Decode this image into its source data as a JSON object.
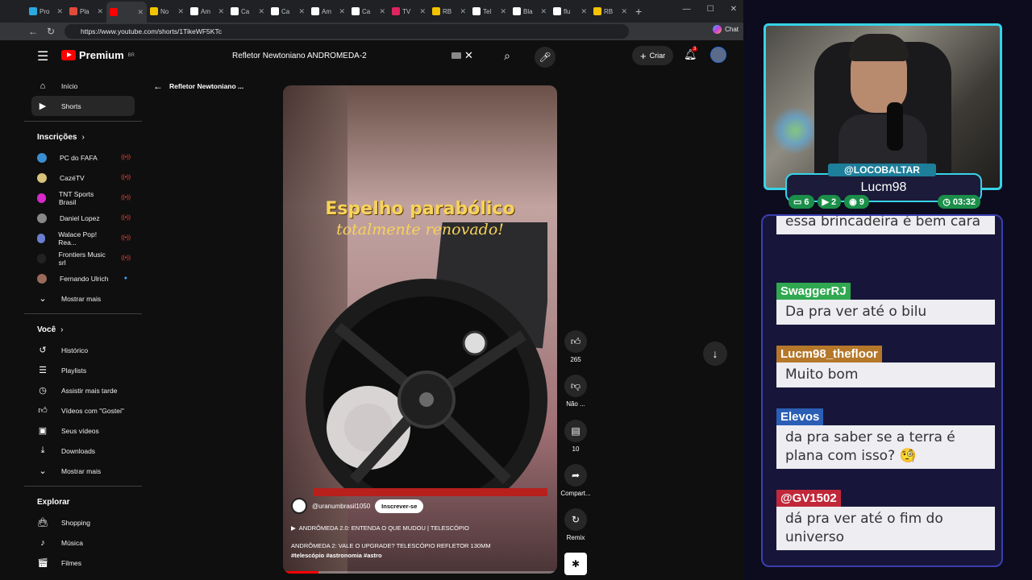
{
  "browser": {
    "tabs": [
      {
        "label": "Pro",
        "color": "#29a9e0"
      },
      {
        "label": "Pla",
        "color": "#e24a3a"
      },
      {
        "label": "",
        "color": "#ff0000"
      },
      {
        "label": "No",
        "color": "#f4c300"
      },
      {
        "label": "Am",
        "color": "#ffffff"
      },
      {
        "label": "Ca",
        "color": "#ffffff"
      },
      {
        "label": "Ca",
        "color": "#ffffff"
      },
      {
        "label": "Am",
        "color": "#ffffff"
      },
      {
        "label": "Ca",
        "color": "#ffffff"
      },
      {
        "label": "TV",
        "color": "#e0245e"
      },
      {
        "label": "RB",
        "color": "#f4c300"
      },
      {
        "label": "Tel",
        "color": "#ffffff"
      },
      {
        "label": "Bla",
        "color": "#ffffff"
      },
      {
        "label": "flu",
        "color": "#ffffff"
      },
      {
        "label": "RB",
        "color": "#f4c300"
      }
    ],
    "url": "https://www.youtube.com/shorts/1TikeWF5KTc",
    "chat_label": "Chat"
  },
  "youtube": {
    "logo_text": "Premium",
    "logo_region": "BR",
    "search_value": "Refletor Newtoniano ANDRÔMEDA-2",
    "create_label": "Criar",
    "notification_count": "3",
    "sidebar": {
      "main": [
        {
          "label": "Início",
          "icon": "home-icon"
        },
        {
          "label": "Shorts",
          "icon": "shorts-icon"
        }
      ],
      "subs_heading": "Inscrições",
      "subs": [
        {
          "label": "PC do FAFA",
          "color": "#3a8fd1",
          "status": "live"
        },
        {
          "label": "CazéTV",
          "color": "#d9c27a",
          "status": "live"
        },
        {
          "label": "TNT Sports Brasil",
          "color": "#d629c9",
          "status": "live"
        },
        {
          "label": "Daniel Lopez",
          "color": "#888888",
          "status": "live"
        },
        {
          "label": "Walace Pop! Rea...",
          "color": "#6a7fd1",
          "status": "live"
        },
        {
          "label": "Frontiers Music srl",
          "color": "#222222",
          "status": "live"
        },
        {
          "label": "Fernando Ulrich",
          "color": "#9a6a5a",
          "status": "new"
        }
      ],
      "subs_more": "Mostrar mais",
      "you_heading": "Você",
      "you": [
        {
          "label": "Histórico",
          "icon": "history-icon"
        },
        {
          "label": "Playlists",
          "icon": "playlists-icon"
        },
        {
          "label": "Assistir mais tarde",
          "icon": "clock-icon"
        },
        {
          "label": "Vídeos com \"Gostei\"",
          "icon": "like-icon"
        },
        {
          "label": "Seus vídeos",
          "icon": "video-icon"
        },
        {
          "label": "Downloads",
          "icon": "download-icon"
        }
      ],
      "you_more": "Mostrar mais",
      "explore_heading": "Explorar",
      "explore": [
        {
          "label": "Shopping",
          "icon": "bag-icon"
        },
        {
          "label": "Música",
          "icon": "music-icon"
        },
        {
          "label": "Filmes",
          "icon": "film-icon"
        }
      ]
    },
    "short": {
      "back_title": "Refletor Newtoniano ...",
      "overlay_line1": "Espelho parabólico",
      "overlay_line2": "totalmente renovado!",
      "channel": "@uranumbrasil1050",
      "subscribe": "Inscrever-se",
      "music": "ANDRÔMEDA 2.0: ENTENDA O QUE MUDOU | TELESCÓPIO",
      "description": "ANDRÔMEDA 2: VALE O UPGRADE? TELESCÓPIO REFLETOR 130MM",
      "tags": "#telescópio #astronomia #astro",
      "progress": 0.13
    },
    "actions": {
      "likes": "265",
      "dislike": "Não ...",
      "comments": "10",
      "share": "Compart...",
      "remix": "Remix"
    }
  },
  "stream": {
    "handle": "@LOCOBALTAR",
    "streamer": "Lucm98",
    "stats": [
      {
        "value": "6",
        "icon": "chat-icon"
      },
      {
        "value": "2",
        "icon": "youtube-icon"
      },
      {
        "value": "9",
        "icon": "kick-icon"
      },
      {
        "value": "03:32",
        "icon": "timer-icon"
      }
    ],
    "chat": [
      {
        "user": "",
        "text": "essa brincadeira é bem cara",
        "color": "#3a3fb0"
      },
      {
        "user": "SwaggerRJ",
        "text": "Da pra ver até o bilu",
        "color": "#2fa84f"
      },
      {
        "user": "Lucm98_thefloor",
        "text": "Muito bom",
        "color": "#b5782a"
      },
      {
        "user": "Elevos",
        "text": "da pra saber se a terra é plana com isso? 🧐",
        "color": "#2a5fb5"
      },
      {
        "user": "@GV1502",
        "text": "dá pra ver até o fim do universo",
        "color": "#c0283a"
      }
    ]
  }
}
